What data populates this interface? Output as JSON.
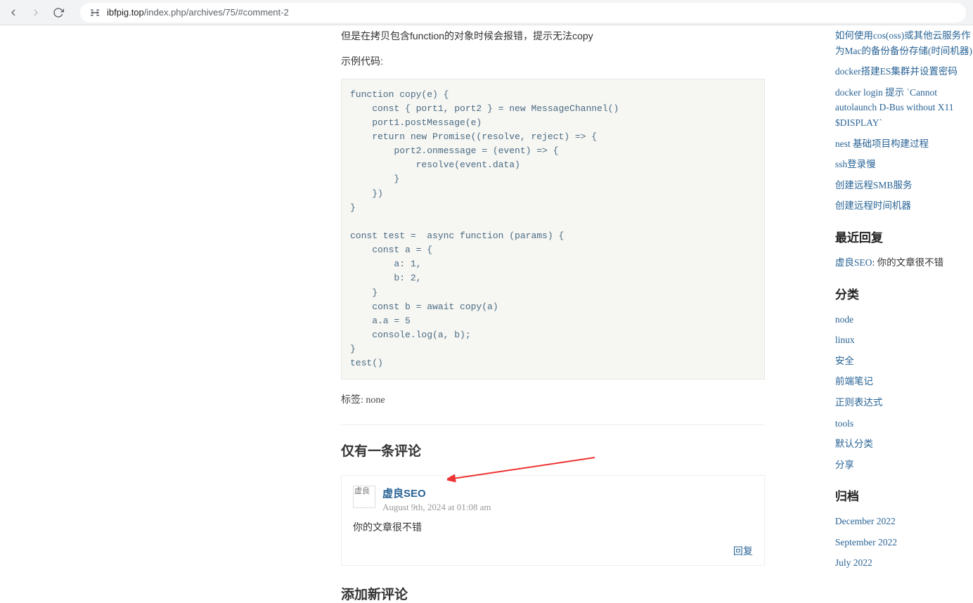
{
  "browser": {
    "url_host": "ibfpig.top",
    "url_path": "/index.php/archives/75/#comment-2"
  },
  "article": {
    "intro_line": "但是在拷贝包含function的对象时候会报错，提示无法copy",
    "sample_label": "示例代码:",
    "code": "function copy(e) {\n    const { port1, port2 } = new MessageChannel()\n    port1.postMessage(e)\n    return new Promise((resolve, reject) => {\n        port2.onmessage = (event) => {\n            resolve(event.data)\n        }\n    })\n}\n\nconst test =  async function (params) {\n    const a = {\n        a: 1,\n        b: 2,\n    }\n    const b = await copy(a)\n    a.a = 5\n    console.log(a, b);\n}\ntest()",
    "tags_label": "标签: ",
    "tags_value": "none"
  },
  "comments": {
    "title": "仅有一条评论",
    "items": [
      {
        "avatar_alt": "虚良",
        "author": "虚良SEO",
        "date": "August 9th, 2024 at 01:08 am",
        "body": "你的文章很不错",
        "reply_label": "回复"
      }
    ],
    "add_title": "添加新评论"
  },
  "sidebar": {
    "recent_posts": [
      "如何使用cos(oss)或其他云服务作为Mac的备份备份存储(时间机器)",
      "docker搭建ES集群并设置密码",
      "docker login 提示 `Cannot autolaunch D-Bus without X11 $DISPLAY`",
      "nest 基础项目构建过程",
      "ssh登录慢",
      "创建远程SMB服务",
      "创建远程时间机器"
    ],
    "recent_reply_title": "最近回复",
    "recent_reply": {
      "author": "虚良SEO",
      "sep": ": ",
      "text": "你的文章很不错"
    },
    "categories_title": "分类",
    "categories": [
      "node",
      "linux",
      "安全",
      "前端笔记",
      "正则表达式",
      "tools",
      "默认分类",
      "分享"
    ],
    "archive_title": "归档",
    "archive": [
      "December 2022",
      "September 2022",
      "July 2022"
    ]
  }
}
